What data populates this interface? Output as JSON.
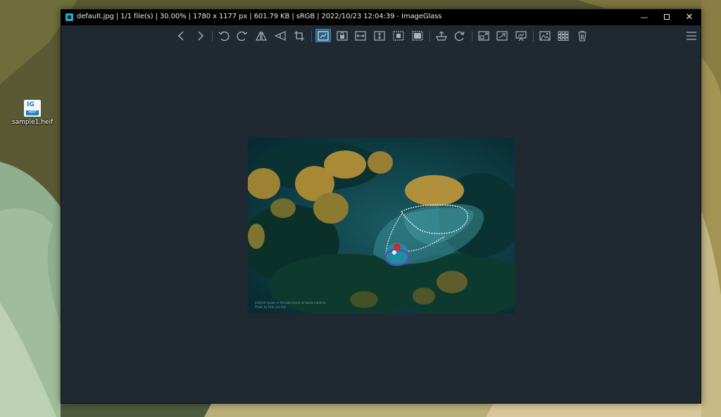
{
  "window": {
    "title": "default.jpg  |  1/1 file(s)  |  30.00%  |  1780 x 1177 px  |  601.79 KB  |  sRGB  |  2022/10/23 12:04:39  - ImageGlass",
    "controls": {
      "minimize": "—",
      "close": "✕"
    }
  },
  "desktop": {
    "file_icon": {
      "label": "sample1.heif",
      "glyph_text": "IG",
      "glyph_tag": "HEIF"
    }
  },
  "photo": {
    "watermark_line1": "Jellyfish spawn in the kelp forest at Santa Catalina",
    "watermark_line2": "Photo by Kelp Lee Ryh"
  },
  "colors": {
    "accent": "#2b5f7e",
    "window_bg": "#202831",
    "titlebar_bg": "#000000"
  },
  "toolbar": [
    {
      "name": "prev-image-icon"
    },
    {
      "name": "next-image-icon"
    },
    {
      "name": "rotate-left-icon"
    },
    {
      "name": "rotate-right-icon"
    },
    {
      "name": "flip-horizontal-icon"
    },
    {
      "name": "flip-vertical-icon"
    },
    {
      "name": "crop-icon"
    },
    {
      "name": "auto-zoom-icon",
      "active": true
    },
    {
      "name": "lock-zoom-icon"
    },
    {
      "name": "scale-to-width-icon"
    },
    {
      "name": "scale-to-height-icon"
    },
    {
      "name": "scale-to-fit-icon"
    },
    {
      "name": "scale-to-fill-icon"
    },
    {
      "name": "color-picker-icon"
    },
    {
      "name": "refresh-icon"
    },
    {
      "name": "window-fit-icon"
    },
    {
      "name": "fullscreen-icon"
    },
    {
      "name": "slideshow-icon"
    },
    {
      "name": "set-wallpaper-icon"
    },
    {
      "name": "gallery-icon"
    },
    {
      "name": "delete-icon"
    },
    {
      "name": "main-menu-icon"
    }
  ]
}
